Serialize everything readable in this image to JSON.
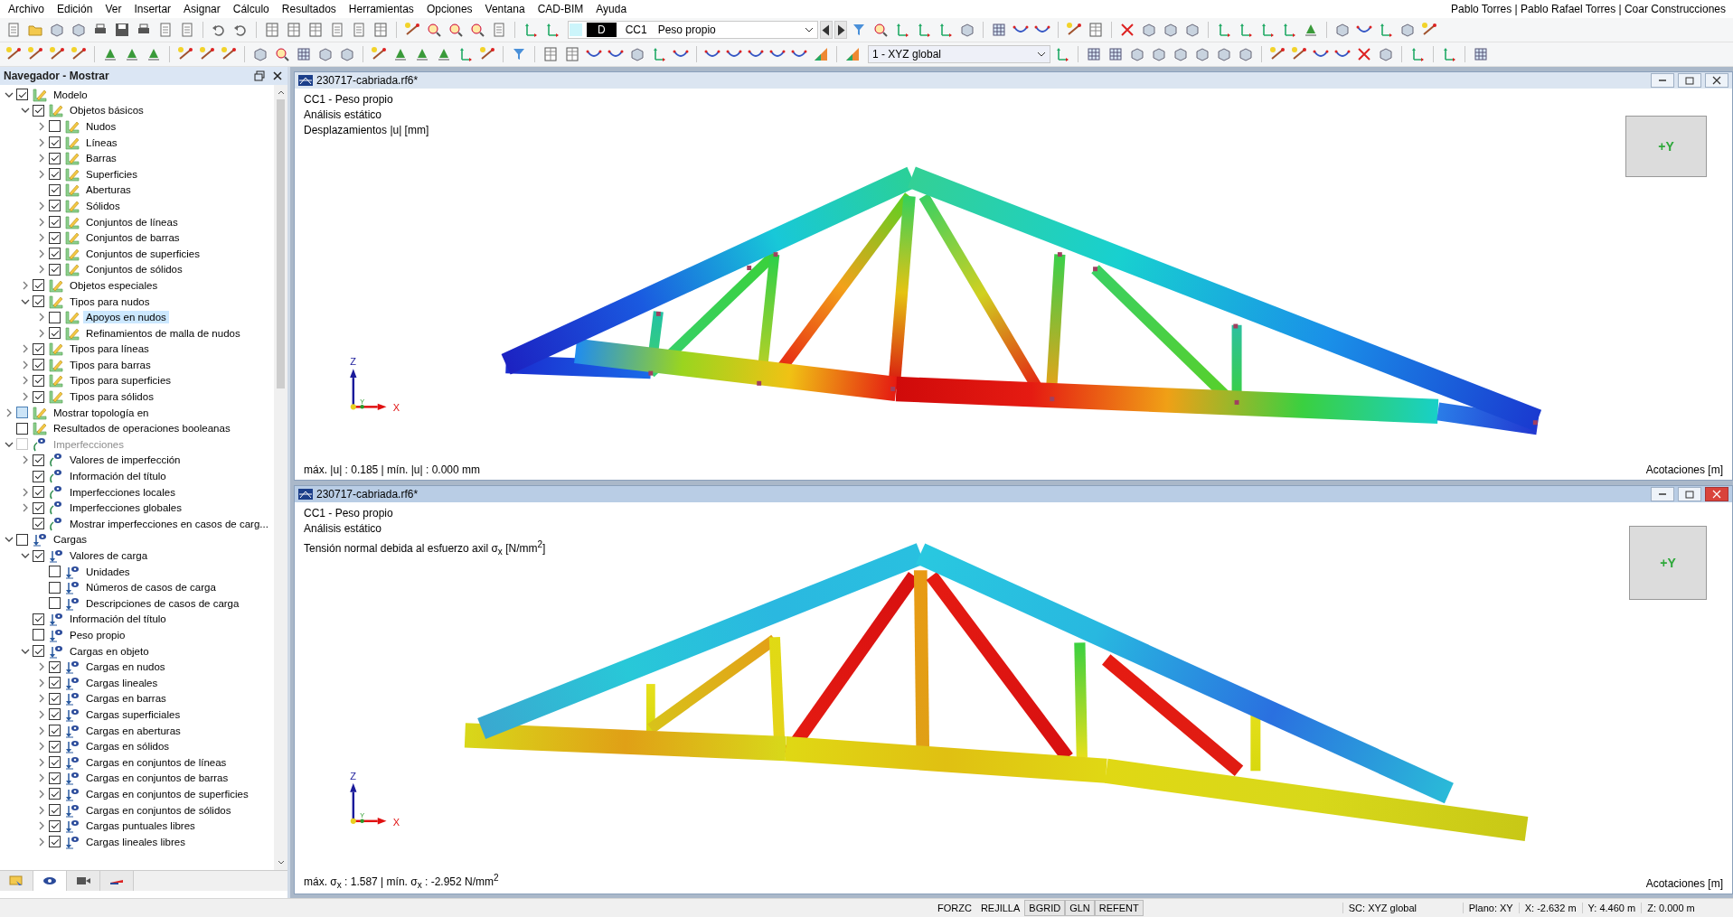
{
  "menu": [
    {
      "label": "Archivo"
    },
    {
      "label": "Edición"
    },
    {
      "label": "Ver"
    },
    {
      "label": "Insertar"
    },
    {
      "label": "Asignar"
    },
    {
      "label": "Cálculo"
    },
    {
      "label": "Resultados"
    },
    {
      "label": "Herramientas"
    },
    {
      "label": "Opciones"
    },
    {
      "label": "Ventana"
    },
    {
      "label": "CAD-BIM"
    },
    {
      "label": "Ayuda"
    }
  ],
  "user": "Pablo Torres | Pablo Rafael Torres | Coar Construcciones",
  "load_case": {
    "tag": "D",
    "code": "CC1",
    "name": "Peso propio"
  },
  "coordinate_system": "1 - XYZ global",
  "navigator": {
    "title": "Navegador - Mostrar",
    "tree": [
      {
        "label": "Modelo",
        "kind": "model",
        "checked": true,
        "indeterminate": false,
        "disabled": false,
        "selected": false,
        "expanded": true,
        "children": [
          {
            "label": "Objetos básicos",
            "kind": "model",
            "checked": true,
            "indeterminate": false,
            "disabled": false,
            "selected": false,
            "expanded": true,
            "children": [
              {
                "label": "Nudos",
                "kind": "model",
                "checked": false,
                "indeterminate": false,
                "disabled": false,
                "selected": false,
                "expanded": false
              },
              {
                "label": "Líneas",
                "kind": "model",
                "checked": true,
                "indeterminate": false,
                "disabled": false,
                "selected": false,
                "expanded": false
              },
              {
                "label": "Barras",
                "kind": "model",
                "checked": true,
                "indeterminate": false,
                "disabled": false,
                "selected": false,
                "expanded": false
              },
              {
                "label": "Superficies",
                "kind": "model",
                "checked": true,
                "indeterminate": false,
                "disabled": false,
                "selected": false,
                "expanded": false
              },
              {
                "label": "Aberturas",
                "kind": "model",
                "checked": true,
                "indeterminate": false,
                "disabled": false,
                "selected": false
              },
              {
                "label": "Sólidos",
                "kind": "model",
                "checked": true,
                "indeterminate": false,
                "disabled": false,
                "selected": false,
                "expanded": false
              },
              {
                "label": "Conjuntos de líneas",
                "kind": "model",
                "checked": true,
                "indeterminate": false,
                "disabled": false,
                "selected": false,
                "expanded": false
              },
              {
                "label": "Conjuntos de barras",
                "kind": "model",
                "checked": true,
                "indeterminate": false,
                "disabled": false,
                "selected": false,
                "expanded": false
              },
              {
                "label": "Conjuntos de superficies",
                "kind": "model",
                "checked": true,
                "indeterminate": false,
                "disabled": false,
                "selected": false,
                "expanded": false
              },
              {
                "label": "Conjuntos de sólidos",
                "kind": "model",
                "checked": true,
                "indeterminate": false,
                "disabled": false,
                "selected": false,
                "expanded": false
              }
            ]
          },
          {
            "label": "Objetos especiales",
            "kind": "model",
            "checked": true,
            "indeterminate": false,
            "disabled": false,
            "selected": false,
            "expanded": false
          },
          {
            "label": "Tipos para nudos",
            "kind": "model",
            "checked": true,
            "indeterminate": false,
            "disabled": false,
            "selected": false,
            "expanded": true,
            "children": [
              {
                "label": "Apoyos en nudos",
                "kind": "model",
                "checked": false,
                "indeterminate": false,
                "disabled": false,
                "selected": true,
                "expanded": false
              },
              {
                "label": "Refinamientos de malla de nudos",
                "kind": "model",
                "checked": true,
                "indeterminate": false,
                "disabled": false,
                "selected": false,
                "expanded": false
              }
            ]
          },
          {
            "label": "Tipos para líneas",
            "kind": "model",
            "checked": true,
            "indeterminate": false,
            "disabled": false,
            "selected": false,
            "expanded": false
          },
          {
            "label": "Tipos para barras",
            "kind": "model",
            "checked": true,
            "indeterminate": false,
            "disabled": false,
            "selected": false,
            "expanded": false
          },
          {
            "label": "Tipos para superficies",
            "kind": "model",
            "checked": true,
            "indeterminate": false,
            "disabled": false,
            "selected": false,
            "expanded": false
          },
          {
            "label": "Tipos para sólidos",
            "kind": "model",
            "checked": true,
            "indeterminate": false,
            "disabled": false,
            "selected": false,
            "expanded": false
          }
        ]
      },
      {
        "label": "Mostrar topología en",
        "kind": "model",
        "checked": false,
        "indeterminate": true,
        "disabled": false,
        "selected": false,
        "expanded": false
      },
      {
        "label": "Resultados de operaciones booleanas",
        "kind": "model",
        "checked": false,
        "indeterminate": false,
        "disabled": false,
        "selected": false
      },
      {
        "label": "Imperfecciones",
        "kind": "imperfection",
        "checked": false,
        "indeterminate": false,
        "disabled": true,
        "selected": false,
        "expanded": true,
        "children": [
          {
            "label": "Valores de imperfección",
            "kind": "imperfection",
            "checked": true,
            "indeterminate": false,
            "disabled": false,
            "selected": false,
            "expanded": false
          },
          {
            "label": "Información del título",
            "kind": "imperfection",
            "checked": true,
            "indeterminate": false,
            "disabled": false,
            "selected": false
          },
          {
            "label": "Imperfecciones locales",
            "kind": "imperfection",
            "checked": true,
            "indeterminate": false,
            "disabled": false,
            "selected": false,
            "expanded": false
          },
          {
            "label": "Imperfecciones globales",
            "kind": "imperfection",
            "checked": true,
            "indeterminate": false,
            "disabled": false,
            "selected": false,
            "expanded": false
          },
          {
            "label": "Mostrar imperfecciones en casos de carg...",
            "kind": "imperfection",
            "checked": true,
            "indeterminate": false,
            "disabled": false,
            "selected": false
          }
        ]
      },
      {
        "label": "Cargas",
        "kind": "load",
        "checked": false,
        "indeterminate": false,
        "disabled": false,
        "selected": false,
        "expanded": true,
        "children": [
          {
            "label": "Valores de carga",
            "kind": "load",
            "checked": true,
            "indeterminate": false,
            "disabled": false,
            "selected": false,
            "expanded": true,
            "children": [
              {
                "label": "Unidades",
                "kind": "load",
                "checked": false,
                "indeterminate": false,
                "disabled": false,
                "selected": false
              },
              {
                "label": "Números de casos de carga",
                "kind": "load",
                "checked": false,
                "indeterminate": false,
                "disabled": false,
                "selected": false
              },
              {
                "label": "Descripciones de casos de carga",
                "kind": "load",
                "checked": false,
                "indeterminate": false,
                "disabled": false,
                "selected": false
              }
            ]
          },
          {
            "label": "Información del título",
            "kind": "load",
            "checked": true,
            "indeterminate": false,
            "disabled": false,
            "selected": false
          },
          {
            "label": "Peso propio",
            "kind": "load",
            "checked": false,
            "indeterminate": false,
            "disabled": false,
            "selected": false
          },
          {
            "label": "Cargas en objeto",
            "kind": "load",
            "checked": true,
            "indeterminate": false,
            "disabled": false,
            "selected": false,
            "expanded": true,
            "children": [
              {
                "label": "Cargas en nudos",
                "kind": "load",
                "checked": true,
                "indeterminate": false,
                "disabled": false,
                "selected": false,
                "expanded": false
              },
              {
                "label": "Cargas lineales",
                "kind": "load",
                "checked": true,
                "indeterminate": false,
                "disabled": false,
                "selected": false,
                "expanded": false
              },
              {
                "label": "Cargas en barras",
                "kind": "load",
                "checked": true,
                "indeterminate": false,
                "disabled": false,
                "selected": false,
                "expanded": false
              },
              {
                "label": "Cargas superficiales",
                "kind": "load",
                "checked": true,
                "indeterminate": false,
                "disabled": false,
                "selected": false,
                "expanded": false
              },
              {
                "label": "Cargas en aberturas",
                "kind": "load",
                "checked": true,
                "indeterminate": false,
                "disabled": false,
                "selected": false,
                "expanded": false
              },
              {
                "label": "Cargas en sólidos",
                "kind": "load",
                "checked": true,
                "indeterminate": false,
                "disabled": false,
                "selected": false,
                "expanded": false
              },
              {
                "label": "Cargas en conjuntos de líneas",
                "kind": "load",
                "checked": true,
                "indeterminate": false,
                "disabled": false,
                "selected": false,
                "expanded": false
              },
              {
                "label": "Cargas en conjuntos de barras",
                "kind": "load",
                "checked": true,
                "indeterminate": false,
                "disabled": false,
                "selected": false,
                "expanded": false
              },
              {
                "label": "Cargas en conjuntos de superficies",
                "kind": "load",
                "checked": true,
                "indeterminate": false,
                "disabled": false,
                "selected": false,
                "expanded": false
              },
              {
                "label": "Cargas en conjuntos de sólidos",
                "kind": "load",
                "checked": true,
                "indeterminate": false,
                "disabled": false,
                "selected": false,
                "expanded": false
              },
              {
                "label": "Cargas puntuales libres",
                "kind": "load",
                "checked": true,
                "indeterminate": false,
                "disabled": false,
                "selected": false,
                "expanded": false
              },
              {
                "label": "Cargas lineales libres",
                "kind": "load",
                "checked": true,
                "indeterminate": false,
                "disabled": false,
                "selected": false,
                "expanded": false
              }
            ]
          }
        ]
      }
    ],
    "tabs": [
      {
        "kind": "display",
        "selected": false
      },
      {
        "kind": "view",
        "selected": true
      },
      {
        "kind": "camera",
        "selected": false
      },
      {
        "kind": "color",
        "selected": false
      }
    ]
  },
  "views": [
    {
      "kind": "displacement",
      "active": false,
      "title": "230717-cabriada.rf6*",
      "info": [
        "CC1 - Peso propio",
        "Análisis estático",
        "Desplazamientos |u| [mm]"
      ],
      "footer": "máx. |u| : 0.185 | mín. |u| : 0.000 mm",
      "dimensions": "Acotaciones [m]",
      "cube": "+Y",
      "axes": {
        "z": "Z",
        "x": "X",
        "y": "Y"
      }
    },
    {
      "kind": "stress",
      "active": true,
      "title": "230717-cabriada.rf6*",
      "info": [
        "CC1 - Peso propio",
        "Análisis estático",
        "Tensión normal debida al esfuerzo axil σ$_{x}$ [N/mm$^{2}$]"
      ],
      "footer": "máx. σ$_{x}$ : 1.587 | mín. σ$_{x}$ : -2.952 N/mm$^{2}$",
      "dimensions": "Acotaciones [m]",
      "cube": "+Y",
      "axes": {
        "z": "Z",
        "x": "X",
        "y": "Y"
      }
    }
  ],
  "status_bar": {
    "toggles": [
      {
        "label": "FORZC",
        "on": false
      },
      {
        "label": "REJILLA",
        "on": false
      },
      {
        "label": "BGRID",
        "on": true
      },
      {
        "label": "GLN",
        "on": true
      },
      {
        "label": "REFENT",
        "on": true
      }
    ],
    "fields": [
      "SC: XYZ global",
      "Plano: XY",
      "X: -2.632 m",
      "Y: 4.460 m",
      "Z: 0.000 m"
    ]
  }
}
